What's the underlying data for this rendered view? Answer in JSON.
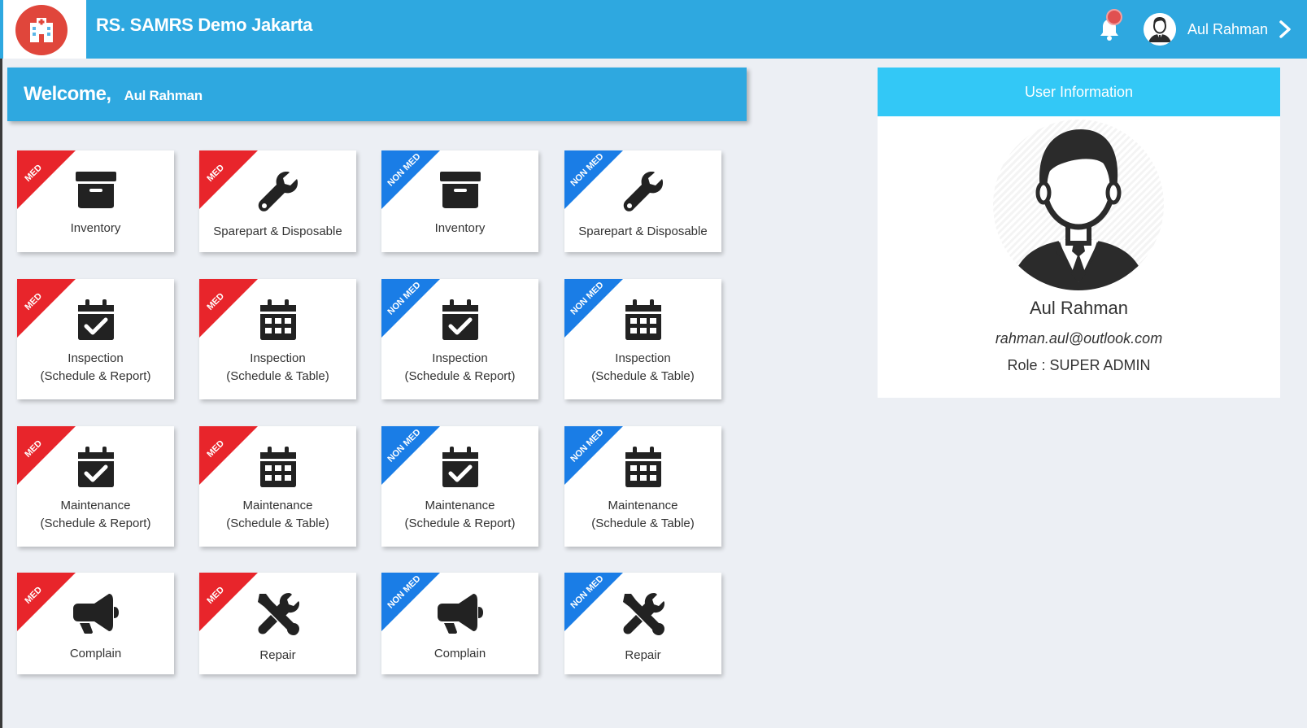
{
  "header": {
    "app_title": "RS. SAMRS Demo Jakarta",
    "logo_icon": "hospital-icon",
    "notification_icon": "bell-icon",
    "user_name": "Aul Rahman",
    "chevron_icon": "chevron-right-icon",
    "bg_color": "#2ea8e0"
  },
  "welcome": {
    "greeting": "Welcome,",
    "name": "Aul Rahman"
  },
  "ribbons": {
    "med": {
      "text": "MED",
      "color": "#e8252b"
    },
    "nonmed": {
      "text": "NON MED",
      "color": "#1a7de6"
    }
  },
  "tiles": [
    {
      "badge": "MED",
      "icon": "archive-box-icon",
      "line1": "Inventory",
      "line2": ""
    },
    {
      "badge": "MED",
      "icon": "wrench-icon",
      "line1": "Sparepart & Disposable",
      "line2": ""
    },
    {
      "badge": "NON MED",
      "icon": "archive-box-icon",
      "line1": "Inventory",
      "line2": ""
    },
    {
      "badge": "NON MED",
      "icon": "wrench-icon",
      "line1": "Sparepart & Disposable",
      "line2": ""
    },
    {
      "badge": "MED",
      "icon": "calendar-check-icon",
      "line1": "Inspection",
      "line2": "(Schedule & Report)"
    },
    {
      "badge": "MED",
      "icon": "calendar-grid-icon",
      "line1": "Inspection",
      "line2": "(Schedule & Table)"
    },
    {
      "badge": "NON MED",
      "icon": "calendar-check-icon",
      "line1": "Inspection",
      "line2": "(Schedule & Report)"
    },
    {
      "badge": "NON MED",
      "icon": "calendar-grid-icon",
      "line1": "Inspection",
      "line2": "(Schedule & Table)"
    },
    {
      "badge": "MED",
      "icon": "calendar-check-icon",
      "line1": "Maintenance",
      "line2": "(Schedule & Report)"
    },
    {
      "badge": "MED",
      "icon": "calendar-grid-icon",
      "line1": "Maintenance",
      "line2": "(Schedule & Table)"
    },
    {
      "badge": "NON MED",
      "icon": "calendar-check-icon",
      "line1": "Maintenance",
      "line2": "(Schedule & Report)"
    },
    {
      "badge": "NON MED",
      "icon": "calendar-grid-icon",
      "line1": "Maintenance",
      "line2": "(Schedule & Table)"
    },
    {
      "badge": "MED",
      "icon": "megaphone-icon",
      "line1": "Complain",
      "line2": ""
    },
    {
      "badge": "MED",
      "icon": "tools-icon",
      "line1": "Repair",
      "line2": ""
    },
    {
      "badge": "NON MED",
      "icon": "megaphone-icon",
      "line1": "Complain",
      "line2": ""
    },
    {
      "badge": "NON MED",
      "icon": "tools-icon",
      "line1": "Repair",
      "line2": ""
    }
  ],
  "user_info": {
    "title": "User Information",
    "name": "Aul Rahman",
    "email": "rahman.aul@outlook.com",
    "role_label": "Role : ",
    "role": "SUPER ADMIN",
    "header_color": "#33c8f6"
  }
}
